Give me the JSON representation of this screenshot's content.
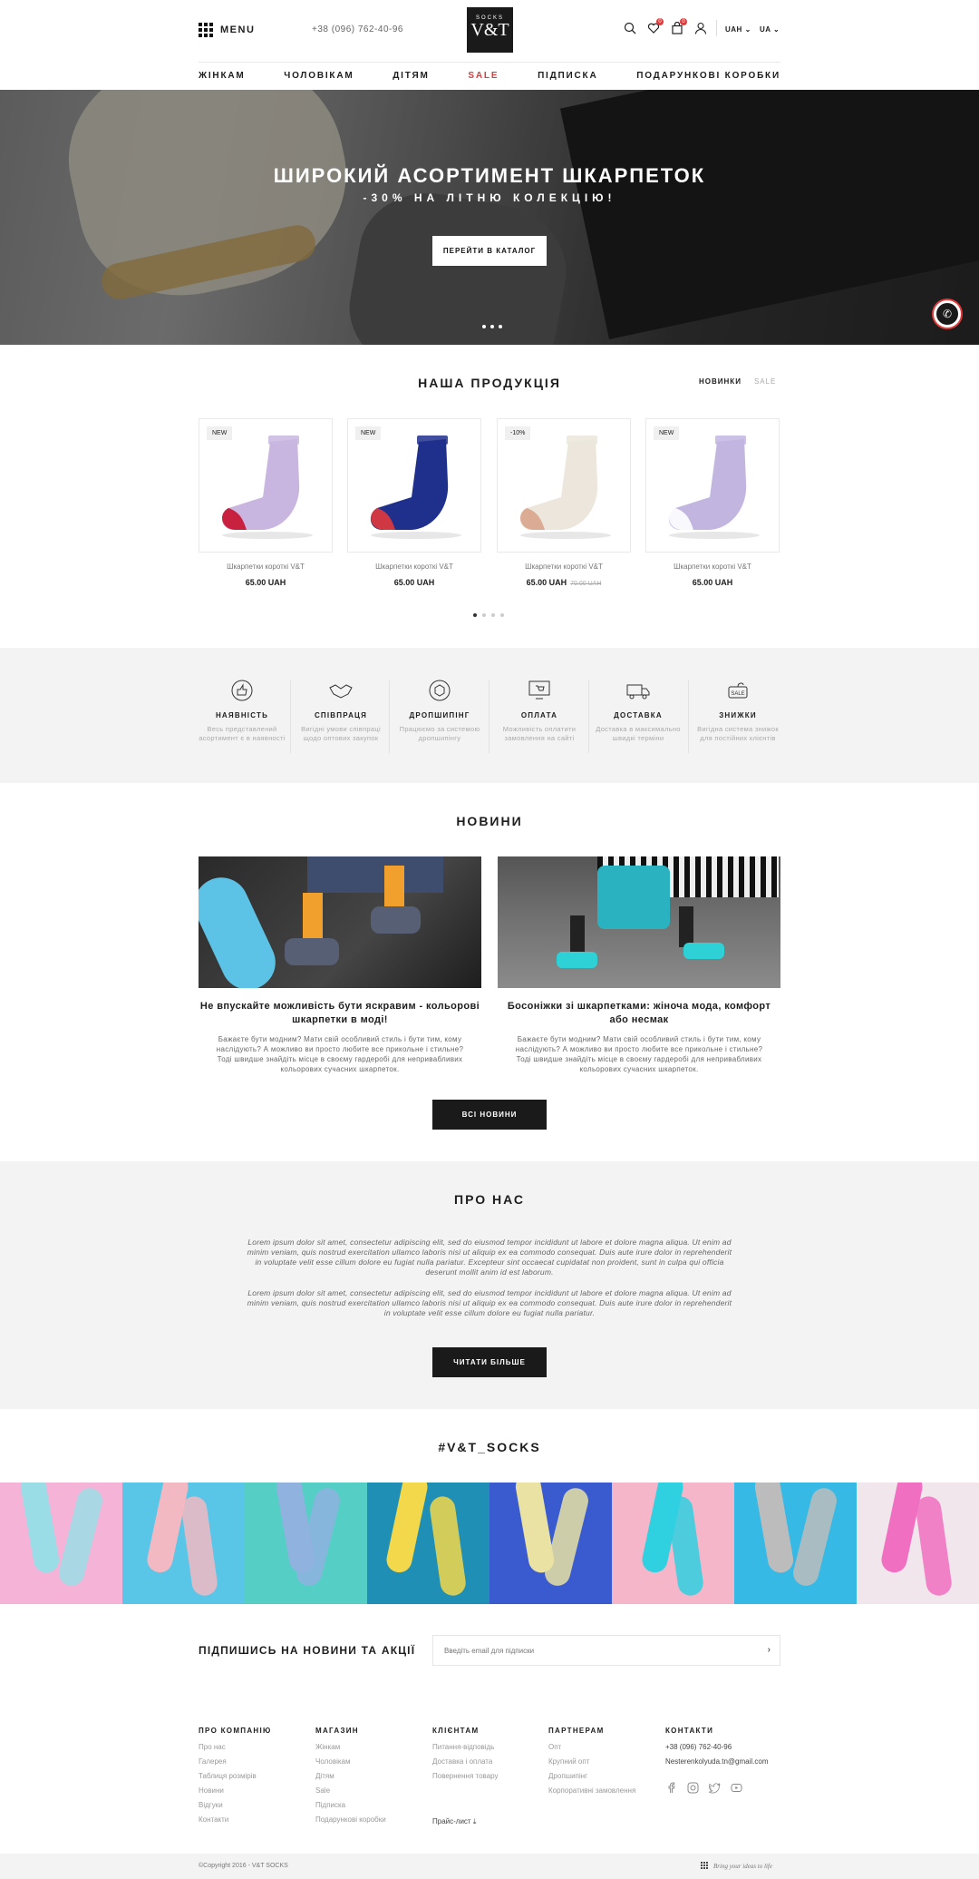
{
  "header": {
    "menu_label": "MENU",
    "phone": "+38 (096) 762-40-96",
    "logo_top": "SOCKS",
    "logo_main": "V&T",
    "wishlist_count": "0",
    "cart_count": "0",
    "currency": "UAH",
    "language": "UA"
  },
  "nav": [
    {
      "label": "ЖІНКАМ"
    },
    {
      "label": "ЧОЛОВІКАМ"
    },
    {
      "label": "ДІТЯМ"
    },
    {
      "label": "SALE"
    },
    {
      "label": "ПІДПИСКА"
    },
    {
      "label": "ПОДАРУНКОВІ КОРОБКИ"
    }
  ],
  "hero": {
    "title": "ШИРОКИЙ АСОРТИМЕНТ ШКАРПЕТОК",
    "subtitle": "-30% НА ЛІТНЮ КОЛЕКЦІЮ!",
    "button": "ПЕРЕЙТИ В КАТАЛОГ"
  },
  "products": {
    "title": "НАША ПРОДУКЦІЯ",
    "filter_new": "НОВИНКИ",
    "filter_sale": "SALE",
    "items": [
      {
        "tag": "NEW",
        "name": "Шкарпетки короткі V&T",
        "price": "65.00 UAH",
        "old_price": "",
        "color": "#c9b6e0",
        "accent": "#c8102e"
      },
      {
        "tag": "NEW",
        "name": "Шкарпетки короткі V&T",
        "price": "65.00 UAH",
        "old_price": "",
        "color": "#1f2f8c",
        "accent": "#e23a3a"
      },
      {
        "tag": "-10%",
        "name": "Шкарпетки короткі V&T",
        "price": "65.00 UAH",
        "old_price": "70.00 UAH",
        "color": "#ece6dc",
        "accent": "#d9a48c"
      },
      {
        "tag": "NEW",
        "name": "Шкарпетки короткі V&T",
        "price": "65.00 UAH",
        "old_price": "",
        "color": "#c2b5e0",
        "accent": "#ffffff"
      }
    ]
  },
  "features": [
    {
      "title": "НАЯВНІСТЬ",
      "text": "Весь представлений асортимент є в наявності"
    },
    {
      "title": "СПІВПРАЦЯ",
      "text": "Вигідні умови співпраці щодо оптових закупок"
    },
    {
      "title": "ДРОПШИПІНГ",
      "text": "Працюємо за системою дропшипінгу"
    },
    {
      "title": "ОПЛАТА",
      "text": "Можливість оплатити замовлення на сайті"
    },
    {
      "title": "ДОСТАВКА",
      "text": "Доставка в максимально швидкі терміни"
    },
    {
      "title": "ЗНИЖКИ",
      "text": "Вигідна система знижок для постійних клієнтів"
    }
  ],
  "news": {
    "title": "НОВИНИ",
    "items": [
      {
        "title": "Не впускайте можливість бути яскравим - кольорові шкарпетки в моді!",
        "text": "Бажаєте бути модним? Мати свій особливий стиль і бути тим, кому наслідують? А можливо ви просто любите все прикольне і стильне? Тоді швидше знайдіть місце в своєму гардеробі для непривабливих кольорових сучасних шкарпеток."
      },
      {
        "title": "Босоніжки зі шкарпетками: жіноча мода, комфорт або несмак",
        "text": "Бажаєте бути модним? Мати свій особливий стиль і бути тим, кому наслідують? А можливо ви просто любите все прикольне і стильне? Тоді швидше знайдіть місце в своєму гардеробі для непривабливих кольорових сучасних шкарпеток."
      }
    ],
    "button": "ВСІ НОВИНИ"
  },
  "about": {
    "title": "ПРО НАС",
    "p1": "Lorem ipsum dolor sit amet, consectetur adipiscing elit, sed do eiusmod tempor incididunt ut labore et dolore magna aliqua. Ut enim ad minim veniam, quis nostrud exercitation ullamco laboris nisi ut aliquip ex ea commodo consequat. Duis aute irure dolor in reprehenderit in voluptate velit esse cillum dolore eu fugiat nulla pariatur. Excepteur sint occaecat cupidatat non proident, sunt in culpa qui officia deserunt mollit anim id est laborum.",
    "p2": "Lorem ipsum dolor sit amet, consectetur adipiscing elit, sed do eiusmod tempor incididunt ut labore et dolore magna aliqua. Ut enim ad minim veniam, quis nostrud exercitation ullamco laboris nisi ut aliquip ex ea commodo consequat. Duis aute irure dolor in reprehenderit in voluptate velit esse cillum dolore eu fugiat nulla pariatur.",
    "button": "ЧИТАТИ БІЛЬШЕ"
  },
  "instagram": {
    "title": "#V&T_SOCKS",
    "tiles": [
      {
        "bg": "#f6b3d8",
        "sock": "#9bdde6"
      },
      {
        "bg": "#59c6e8",
        "sock": "#f3b9c2"
      },
      {
        "bg": "#55cfc6",
        "sock": "#8fb2de"
      },
      {
        "bg": "#1f8fb5",
        "sock": "#f2d84a"
      },
      {
        "bg": "#3a5bd0",
        "sock": "#e9e2a2"
      },
      {
        "bg": "#f4b6c8",
        "sock": "#2fd0e0"
      },
      {
        "bg": "#37b9e5",
        "sock": "#bcbcbc"
      },
      {
        "bg": "#f1e6ec",
        "sock": "#f06fc0"
      }
    ]
  },
  "subscribe": {
    "title": "ПІДПИШИСЬ НА НОВИНИ ТА АКЦІЇ",
    "placeholder": "Введіть email для підписки"
  },
  "footer": {
    "columns": [
      {
        "title": "ПРО КОМПАНІЮ",
        "links": [
          "Про нас",
          "Галерея",
          "Таблиця розмірів",
          "Новини",
          "Відгуки",
          "Контакти"
        ]
      },
      {
        "title": "МАГАЗИН",
        "links": [
          "Жінкам",
          "Чоловікам",
          "Дітям",
          "Sale",
          "Підписка",
          "Подарункові коробки"
        ]
      },
      {
        "title": "КЛІЄНТАМ",
        "links": [
          "Питання-відповідь",
          "Доставка і оплата",
          "Повернення товару"
        ]
      },
      {
        "title": "ПАРТНЕРАМ",
        "links": [
          "Опт",
          "Крупний опт",
          "Дропшипінг",
          "Корпоративні замовлення"
        ]
      },
      {
        "title": "КОНТАКТИ",
        "links": [
          "+38 (096) 762-40-96",
          "Nesterenkolyuda.tn@gmail.com"
        ]
      }
    ],
    "price_list": "Прайс-лист",
    "copyright": "©Copyright 2016 - V&T SOCKS",
    "credit": "Bring your ideas to life"
  }
}
